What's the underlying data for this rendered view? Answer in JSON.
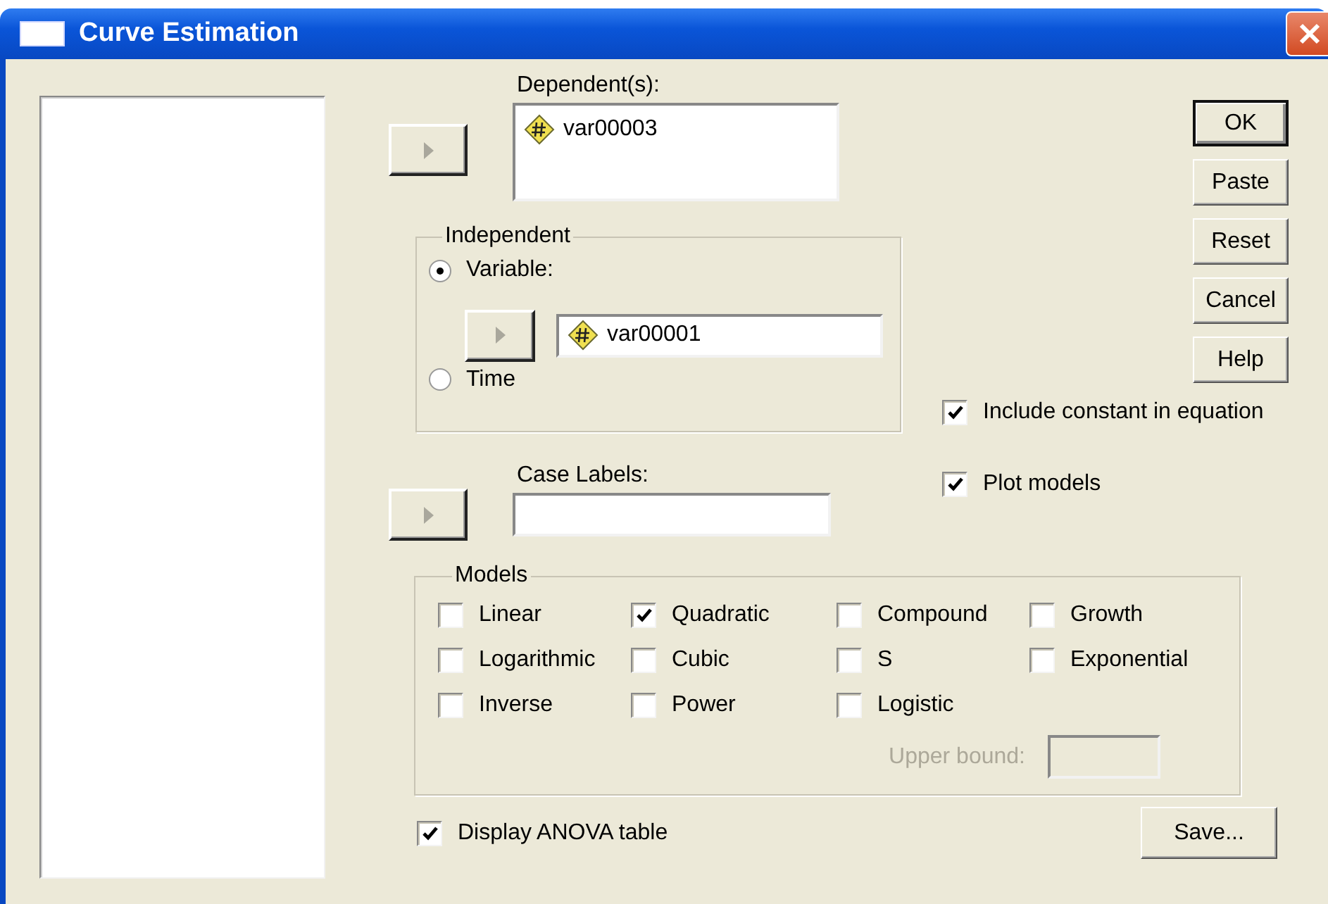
{
  "window": {
    "title": "Curve Estimation"
  },
  "dependent": {
    "label": "Dependent(s):",
    "items": [
      {
        "name": "var00003"
      }
    ]
  },
  "independent": {
    "title": "Independent",
    "options": [
      {
        "label": "Variable:",
        "selected": true
      },
      {
        "label": "Time",
        "selected": false
      }
    ],
    "variable": "var00001"
  },
  "case_labels": {
    "label": "Case Labels:"
  },
  "buttons": [
    {
      "label": "OK",
      "default": true
    },
    {
      "label": "Paste",
      "default": false
    },
    {
      "label": "Reset",
      "default": false
    },
    {
      "label": "Cancel",
      "default": false
    },
    {
      "label": "Help",
      "default": false
    }
  ],
  "options": [
    {
      "label": "Include constant in equation",
      "checked": true
    },
    {
      "label": "Plot models",
      "checked": true
    }
  ],
  "models": {
    "title": "Models",
    "items": [
      {
        "label": "Linear",
        "checked": false
      },
      {
        "label": "Quadratic",
        "checked": true
      },
      {
        "label": "Compound",
        "checked": false
      },
      {
        "label": "Growth",
        "checked": false
      },
      {
        "label": "Logarithmic",
        "checked": false
      },
      {
        "label": "Cubic",
        "checked": false
      },
      {
        "label": "S",
        "checked": false
      },
      {
        "label": "Exponential",
        "checked": false
      },
      {
        "label": "Inverse",
        "checked": false
      },
      {
        "label": "Power",
        "checked": false
      },
      {
        "label": "Logistic",
        "checked": false
      }
    ],
    "upper_bound": {
      "label": "Upper bound:",
      "disabled": true
    }
  },
  "display_anova": {
    "label": "Display ANOVA table",
    "checked": true
  },
  "save_button": "Save..."
}
